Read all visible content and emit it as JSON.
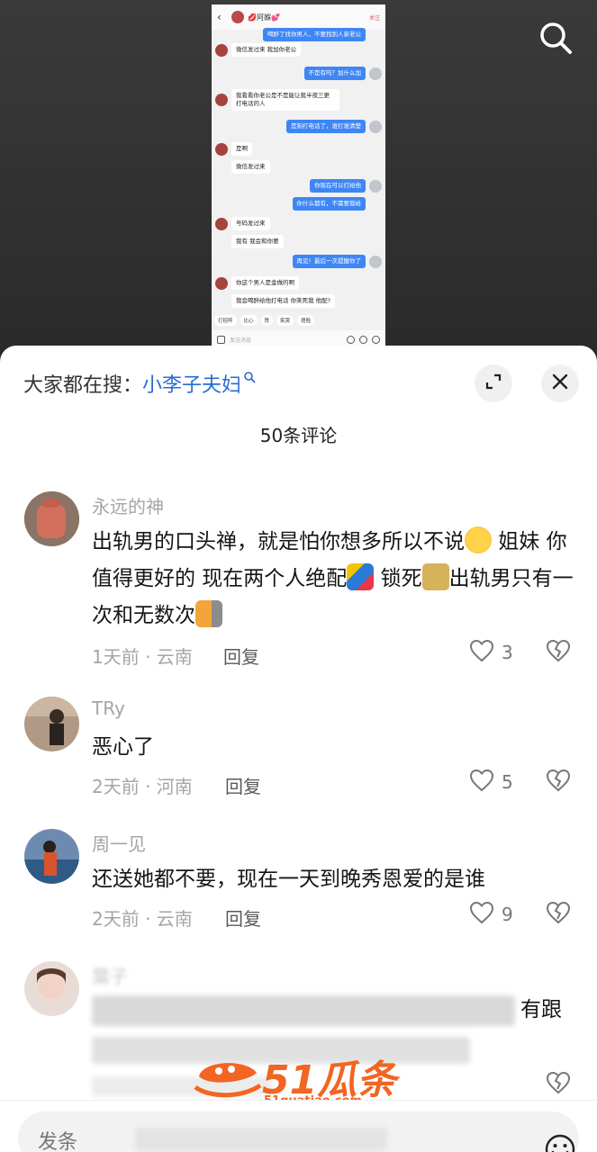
{
  "video": {
    "chat_title": "💋阿媬💕",
    "follow_label": "关注",
    "messages": [
      {
        "side": "out-top",
        "text": "喝醉了找你男人，不要找别人家老公"
      },
      {
        "side": "in",
        "text": "微信发过来 我加你老公"
      },
      {
        "side": "out",
        "text": "不是有吗？加什么加"
      },
      {
        "side": "in",
        "text": "我看看你老公是不是能让我半夜三更打电话的人"
      },
      {
        "side": "out",
        "text": "是狗打电话了，谁打谁清楚"
      },
      {
        "side": "in",
        "text": "是啊"
      },
      {
        "side": "in2",
        "text": "微信发过来"
      },
      {
        "side": "out",
        "text": "你现在可以打给他"
      },
      {
        "side": "out2",
        "text": "你什么都有，不需要我给"
      },
      {
        "side": "in",
        "text": "号码发过来"
      },
      {
        "side": "in2",
        "text": "我有 我会和你要"
      },
      {
        "side": "out",
        "text": "再见！最后一次提醒你了"
      },
      {
        "side": "in",
        "text": "你这个男人是金做的啊"
      },
      {
        "side": "in2",
        "text": "我会喝醉给他打电话 你笑死我 他配?"
      }
    ],
    "quick_chips": [
      "打招呼",
      "比心",
      "赞",
      "笑哭",
      "捂脸"
    ],
    "input_placeholder": "发送消息"
  },
  "sheet": {
    "trending_prefix": "大家都在搜：",
    "trending_keyword": "小李子夫妇",
    "comment_count": "50条评论",
    "comments": [
      {
        "user": "永远的神",
        "text_1": "出轨男的口头禅，就是怕你想多所以不说",
        "text_2": " 姐妹 你值得更好的 现在两个人绝配",
        "text_3": " 锁死",
        "text_4": "出轨男只有一次和无数次",
        "meta": "1天前 · 云南",
        "reply": "回复",
        "likes": "3"
      },
      {
        "user": "TRy",
        "text": "恶心了",
        "meta": "2天前 · 河南",
        "reply": "回复",
        "likes": "5"
      },
      {
        "user": "周一见",
        "text": "还送她都不要，现在一天到晚秀恩爱的是谁",
        "meta": "2天前 · 云南",
        "reply": "回复",
        "likes": "9"
      },
      {
        "user": "葉子",
        "text_tail": "有跟"
      }
    ],
    "input_placeholder": "发条"
  },
  "watermark": {
    "brand": "51瓜条",
    "domain": "51guatiao.com"
  },
  "colors": {
    "link_blue": "#2a6bd4",
    "chat_blue": "#3f86f5",
    "watermark_orange": "#f26522"
  }
}
